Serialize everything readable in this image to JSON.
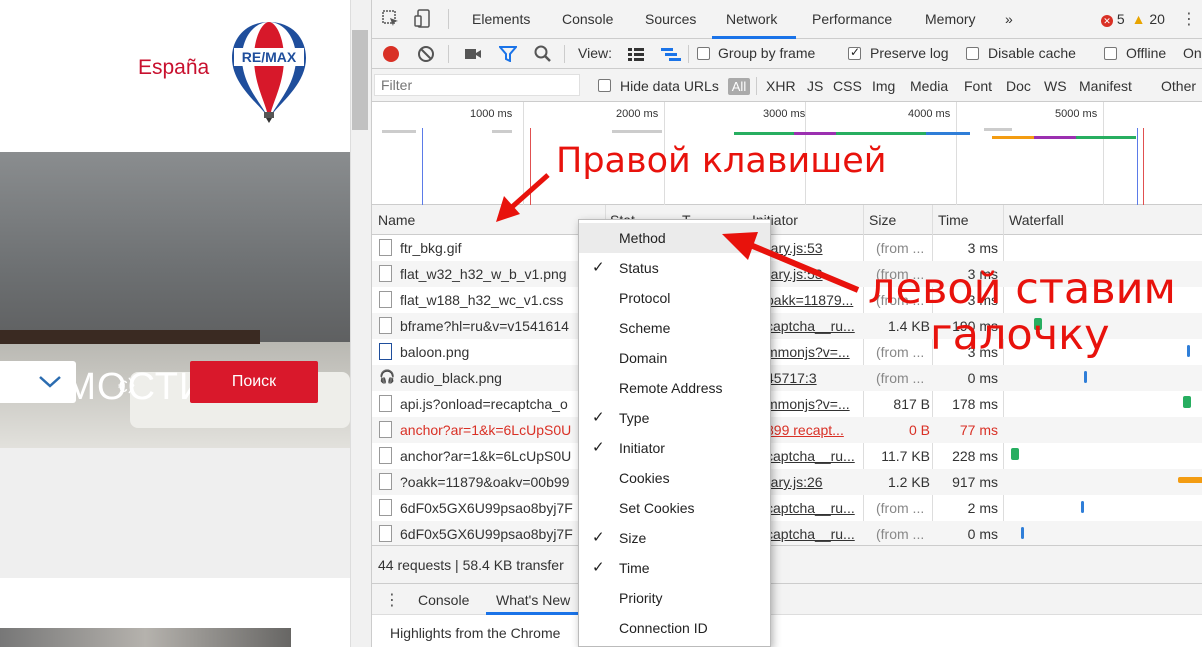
{
  "site": {
    "country": "España",
    "logo_text": "RE/MAX",
    "hero_title": "ЖИМОСТИ",
    "currency": "€〉",
    "search_button": "Поиск"
  },
  "devtools": {
    "tabs": [
      "Elements",
      "Console",
      "Sources",
      "Network",
      "Performance",
      "Memory"
    ],
    "active_tab": "Network",
    "more_tabs": "»",
    "errors": "5",
    "warnings": "20",
    "toolbar": {
      "view_label": "View:",
      "group_by_frame": "Group by frame",
      "preserve_log": "Preserve log",
      "disable_cache": "Disable cache",
      "offline": "Offline",
      "online": "On"
    },
    "filter": {
      "placeholder": "Filter",
      "hide_data_urls": "Hide data URLs",
      "all": "All",
      "types": [
        "XHR",
        "JS",
        "CSS",
        "Img",
        "Media",
        "Font",
        "Doc",
        "WS",
        "Manifest",
        "Other"
      ]
    },
    "timeline_ticks": [
      "1000 ms",
      "2000 ms",
      "3000 ms",
      "4000 ms",
      "5000 ms"
    ],
    "columns": {
      "name": "Name",
      "status": "Stat",
      "type": "T",
      "initiator": "Initiator",
      "size": "Size",
      "time": "Time",
      "waterfall": "Waterfall"
    },
    "rows": [
      {
        "name": "ftr_bkg.gif",
        "initiator": "rary.js:53",
        "size": "(from ...",
        "time": "3 ms",
        "error": false
      },
      {
        "name": "flat_w32_h32_w_b_v1.png",
        "initiator": "rary.js:53",
        "size": "(from ...",
        "time": "3 ms",
        "error": false
      },
      {
        "name": "flat_w188_h32_wc_v1.css",
        "initiator": "oakk=11879...",
        "size": "(from ...",
        "time": "3 ms",
        "error": false
      },
      {
        "name": "bframe?hl=ru&v=v1541614",
        "initiator": "captcha__ru...",
        "size": "1.4 KB",
        "time": "190 ms",
        "error": false
      },
      {
        "name": "baloon.png",
        "initiator": "mmonjs?v=...",
        "size": "(from ...",
        "time": "3 ms",
        "error": false
      },
      {
        "name": "audio_black.png",
        "initiator": "45717:3",
        "size": "(from ...",
        "time": "0 ms",
        "error": false
      },
      {
        "name": "api.js?onload=recaptcha_o",
        "initiator": "mmonjs?v=...",
        "size": "817 B",
        "time": "178 ms",
        "error": false
      },
      {
        "name": "anchor?ar=1&k=6LcUpS0U",
        "initiator": "899 recapt...",
        "size": "0 B",
        "time": "77 ms",
        "error": true
      },
      {
        "name": "anchor?ar=1&k=6LcUpS0U",
        "initiator": "captcha__ru...",
        "size": "11.7 KB",
        "time": "228 ms",
        "error": false
      },
      {
        "name": "?oakk=11879&oakv=00b99",
        "initiator": "rary.js:26",
        "size": "1.2 KB",
        "time": "917 ms",
        "error": false
      },
      {
        "name": "6dF0x5GX6U99psao8byj7F",
        "initiator": "captcha__ru...",
        "size": "(from ...",
        "time": "2 ms",
        "error": false
      },
      {
        "name": "6dF0x5GX6U99psao8byj7F",
        "initiator": "captcha__ru...",
        "size": "(from ...",
        "time": "0 ms",
        "error": false
      }
    ],
    "summary": "44 requests  |  58.4 KB transfer",
    "drawer_tabs": [
      "Console",
      "What's New"
    ],
    "drawer_body": "Highlights from the Chrome"
  },
  "context_menu": [
    {
      "label": "Method",
      "checked": false,
      "highlighted": true
    },
    {
      "label": "Status",
      "checked": true
    },
    {
      "label": "Protocol",
      "checked": false
    },
    {
      "label": "Scheme",
      "checked": false
    },
    {
      "label": "Domain",
      "checked": false
    },
    {
      "label": "Remote Address",
      "checked": false
    },
    {
      "label": "Type",
      "checked": true
    },
    {
      "label": "Initiator",
      "checked": true
    },
    {
      "label": "Cookies",
      "checked": false
    },
    {
      "label": "Set Cookies",
      "checked": false
    },
    {
      "label": "Size",
      "checked": true
    },
    {
      "label": "Time",
      "checked": true
    },
    {
      "label": "Priority",
      "checked": false
    },
    {
      "label": "Connection ID",
      "checked": false
    }
  ],
  "annotations": {
    "right_click": "Правой клавишей",
    "left_check_line1": "левой ставим",
    "left_check_line2": "галочку"
  },
  "colors": {
    "remax_red": "#c8102e",
    "search_button": "#d9182b",
    "devtools_blue": "#1a73e8",
    "annotation_red": "#e8120c",
    "error_red": "#d93025"
  }
}
